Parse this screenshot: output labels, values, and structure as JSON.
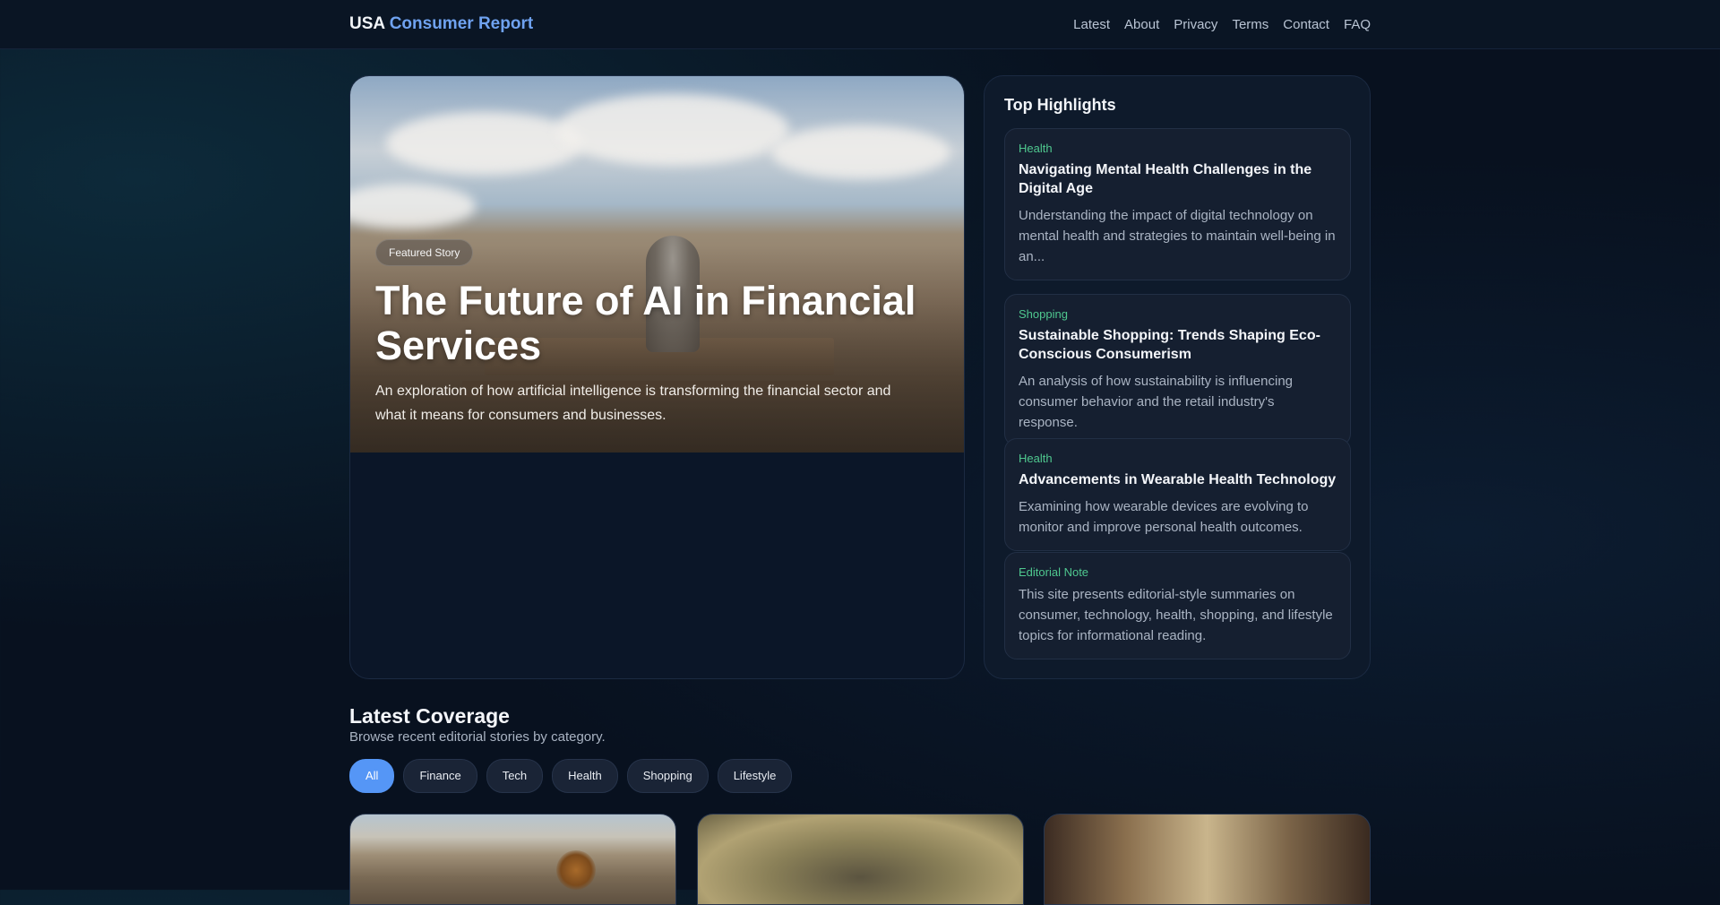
{
  "header": {
    "brand_prefix": "USA",
    "brand_name": "Consumer Report",
    "nav": [
      "Latest",
      "About",
      "Privacy",
      "Terms",
      "Contact",
      "FAQ"
    ]
  },
  "hero": {
    "badge": "Featured Story",
    "title": "The Future of AI in Financial Services",
    "subtitle": "An exploration of how artificial intelligence is transforming the financial sector and what it means for consumers and businesses."
  },
  "highlights": {
    "title": "Top Highlights",
    "items": [
      {
        "category": "Health",
        "title": "Navigating Mental Health Challenges in the Digital Age",
        "desc": "Understanding the impact of digital technology on mental health and strategies to maintain well-being in an..."
      },
      {
        "category": "Shopping",
        "title": "Sustainable Shopping: Trends Shaping Eco-Conscious Consumerism",
        "desc": "An analysis of how sustainability is influencing consumer behavior and the retail industry's response."
      },
      {
        "category": "Health",
        "title": "Advancements in Wearable Health Technology",
        "desc": "Examining how wearable devices are evolving to monitor and improve personal health outcomes."
      }
    ],
    "note": {
      "category": "Editorial Note",
      "desc": "This site presents editorial-style summaries on consumer, technology, health, shopping, and lifestyle topics for informational reading."
    }
  },
  "latest": {
    "title": "Latest Coverage",
    "subtitle": "Browse recent editorial stories by category.",
    "filters": [
      "All",
      "Finance",
      "Tech",
      "Health",
      "Shopping",
      "Lifestyle"
    ],
    "active_filter": "All"
  },
  "colors": {
    "accent": "#6fa2f0",
    "category": "#4fc88f",
    "active_chip": "#5596f6"
  }
}
